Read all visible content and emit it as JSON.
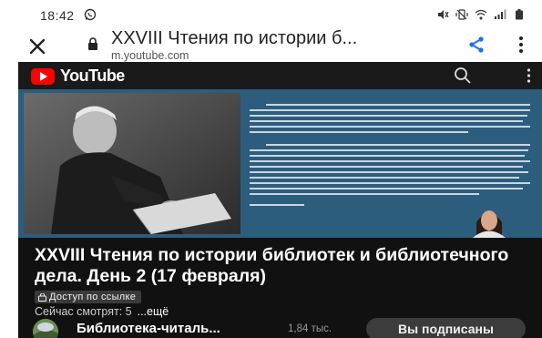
{
  "status_bar": {
    "time": "18:42",
    "icons": [
      "whatsapp-icon",
      "mute-icon",
      "vibrate-icon",
      "wifi-icon",
      "signal-icon",
      "battery-icon"
    ]
  },
  "browser": {
    "page_title": "XXVIII Чтения по истории б...",
    "url": "m.youtube.com",
    "icons": [
      "close-icon",
      "lock-icon",
      "share-icon",
      "more-vert-icon"
    ]
  },
  "youtube_header": {
    "logo_text": "YouTube",
    "icons": [
      "youtube-play-icon",
      "search-icon",
      "more-vert-icon"
    ]
  },
  "video": {
    "title": "XXVIII Чтения по истории библиотек и библиотечного дела. День 2 (17 февраля)",
    "link_badge": "Доступ по ссылке",
    "watching": "Сейчас смотрят: 5",
    "more": "...ещё"
  },
  "channel": {
    "name": "Библиотека-читаль...",
    "subscribers": "1,84 тыс.",
    "subscribe_label": "Вы подписаны"
  },
  "colors": {
    "brand_red": "#ff0000",
    "dark_bg": "#111111",
    "slide_blue": "#2c5d7d",
    "share_blue": "#1a73e8"
  }
}
